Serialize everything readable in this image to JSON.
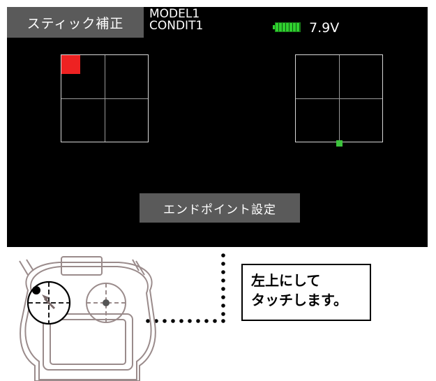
{
  "header": {
    "title": "スティック補正",
    "model": "MODEL1",
    "condition": "CONDIT1",
    "battery_voltage": "7.9V"
  },
  "sticks": {
    "left": {
      "marker": "top-left corner",
      "marker_color": "#ee2222"
    },
    "right": {
      "marker": "bottom center",
      "marker_color": "#3cc33c"
    }
  },
  "button": {
    "label": "エンドポイント設定"
  },
  "instruction": {
    "line1": "左上にして",
    "line2": "タッチします。"
  },
  "icons": [
    "battery-icon",
    "up-arrow-icon",
    "transmitter-icon"
  ]
}
